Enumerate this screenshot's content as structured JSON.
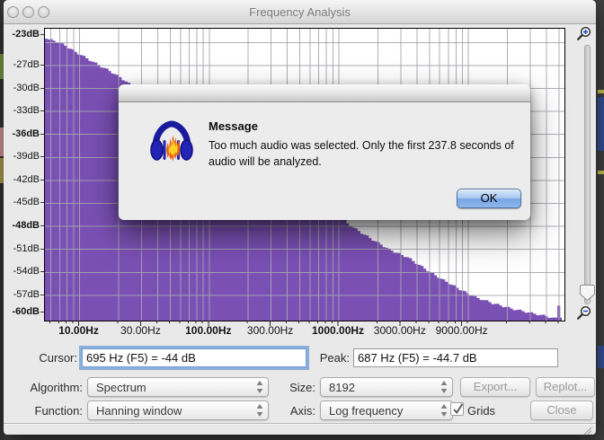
{
  "window": {
    "title": "Frequency Analysis"
  },
  "dialog": {
    "heading": "Message",
    "body_line1": "Too much audio was selected.  Only the first 237.8 seconds of",
    "body_line2": "audio will be analyzed.",
    "ok_label": "OK",
    "icon": "audacity-headphones-logo"
  },
  "cursor_row": {
    "cursor_label": "Cursor:",
    "cursor_value": "695 Hz (F5) = -44 dB",
    "peak_label": "Peak:",
    "peak_value": "687 Hz (F5) = -44.7 dB"
  },
  "controls": {
    "algorithm_label": "Algorithm:",
    "algorithm_value": "Spectrum",
    "size_label": "Size:",
    "size_value": "8192",
    "export_label": "Export...",
    "replot_label": "Replot...",
    "function_label": "Function:",
    "function_value": "Hanning window",
    "axis_label": "Axis:",
    "axis_value": "Log frequency",
    "grids_label": "Grids",
    "grids_checked": true,
    "close_label": "Close"
  },
  "zoom_slider": {
    "zoom_in_icon": "magnifier-plus",
    "zoom_out_icon": "magnifier-minus"
  },
  "chart_data": {
    "type": "area",
    "title": "Spectrum frequency analysis",
    "x_axis": {
      "scale": "log",
      "unit": "Hz",
      "min_hz": 5.4,
      "max_hz": 55000,
      "ticks": [
        {
          "hz": 10,
          "label": "10.00Hz",
          "bold": true
        },
        {
          "hz": 30,
          "label": "30.00Hz",
          "bold": false
        },
        {
          "hz": 100,
          "label": "100.00Hz",
          "bold": true
        },
        {
          "hz": 300,
          "label": "300.00Hz",
          "bold": false
        },
        {
          "hz": 1000,
          "label": "1000.00Hz",
          "bold": true
        },
        {
          "hz": 3000,
          "label": "3000.00Hz",
          "bold": false
        },
        {
          "hz": 9000,
          "label": "9000.00Hz",
          "bold": false
        }
      ]
    },
    "y_axis": {
      "unit": "dB",
      "max_db": -22.2,
      "min_db": -60.3,
      "grid_step_db": 3,
      "ticks": [
        {
          "db": -23,
          "label": "-23dB",
          "bold": true
        },
        {
          "db": -27,
          "label": "-27dB",
          "bold": false
        },
        {
          "db": -30,
          "label": "-30dB",
          "bold": false
        },
        {
          "db": -33,
          "label": "-33dB",
          "bold": false
        },
        {
          "db": -36,
          "label": "-36dB",
          "bold": true
        },
        {
          "db": -39,
          "label": "-39dB",
          "bold": false
        },
        {
          "db": -42,
          "label": "-42dB",
          "bold": false
        },
        {
          "db": -45,
          "label": "-45dB",
          "bold": false
        },
        {
          "db": -48,
          "label": "-48dB",
          "bold": true
        },
        {
          "db": -51,
          "label": "-51dB",
          "bold": false
        },
        {
          "db": -54,
          "label": "-54dB",
          "bold": false
        },
        {
          "db": -57,
          "label": "-57dB",
          "bold": false
        },
        {
          "db": -60,
          "label": "-60dB",
          "bold": true
        }
      ]
    },
    "series": [
      {
        "name": "spectrum",
        "points_hz_db": [
          [
            5.4,
            -23.5
          ],
          [
            6.5,
            -23.8
          ],
          [
            8,
            -24.6
          ],
          [
            10,
            -25.6
          ],
          [
            13,
            -26.7
          ],
          [
            16,
            -27.5
          ],
          [
            20,
            -28.5
          ],
          [
            26,
            -29.9
          ],
          [
            33,
            -31.2
          ],
          [
            42,
            -32.5
          ],
          [
            55,
            -33.6
          ],
          [
            70,
            -34.8
          ],
          [
            90,
            -36.0
          ],
          [
            120,
            -37.5
          ],
          [
            160,
            -39.0
          ],
          [
            220,
            -40.4
          ],
          [
            300,
            -42.0
          ],
          [
            420,
            -43.3
          ],
          [
            560,
            -44.1
          ],
          [
            690,
            -44.6
          ],
          [
            900,
            -46.0
          ],
          [
            1200,
            -47.9
          ],
          [
            1700,
            -49.5
          ],
          [
            2400,
            -51.0
          ],
          [
            3300,
            -52.0
          ],
          [
            4500,
            -53.5
          ],
          [
            6000,
            -54.8
          ],
          [
            8400,
            -56.2
          ],
          [
            11000,
            -57.2
          ],
          [
            15000,
            -58.0
          ],
          [
            22000,
            -58.8
          ],
          [
            30000,
            -59.3
          ],
          [
            39000,
            -59.7
          ],
          [
            45000,
            -60.0
          ],
          [
            47000,
            -59.9
          ],
          [
            48500,
            -58.2
          ],
          [
            51000,
            -59.9
          ],
          [
            52500,
            -60.0
          ]
        ]
      }
    ],
    "colors": {
      "fill": "#7b50b5",
      "grid": "#a7a7af",
      "plot_bg": "#ffffff",
      "tick": "#222222"
    },
    "legend": null,
    "grid": true
  }
}
